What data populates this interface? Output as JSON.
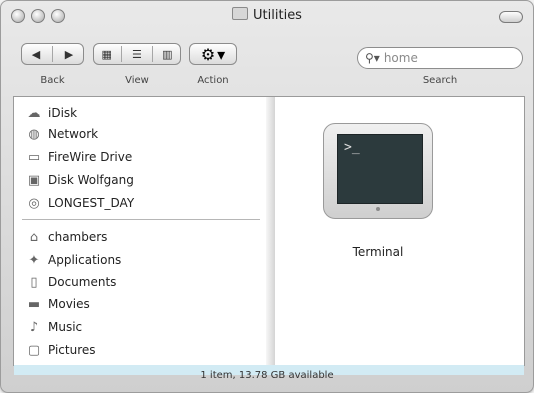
{
  "window": {
    "title": "Utilities"
  },
  "toolbar": {
    "back_label": "Back",
    "view_label": "View",
    "action_label": "Action",
    "search_label": "Search",
    "search_placeholder": "home"
  },
  "sidebar": {
    "devices": [
      {
        "label": "iDisk",
        "icon": "idisk-icon"
      },
      {
        "label": "Network",
        "icon": "network-icon"
      },
      {
        "label": "FireWire Drive",
        "icon": "drive-icon"
      },
      {
        "label": "Disk Wolfgang",
        "icon": "disk-icon"
      },
      {
        "label": "LONGEST_DAY",
        "icon": "cd-icon"
      }
    ],
    "places": [
      {
        "label": "chambers",
        "icon": "home-icon"
      },
      {
        "label": "Applications",
        "icon": "applications-icon"
      },
      {
        "label": "Documents",
        "icon": "documents-icon"
      },
      {
        "label": "Movies",
        "icon": "movies-icon"
      },
      {
        "label": "Music",
        "icon": "music-icon"
      },
      {
        "label": "Pictures",
        "icon": "pictures-icon"
      }
    ]
  },
  "main": {
    "items": [
      {
        "label": "Terminal",
        "icon": "terminal-icon"
      }
    ]
  },
  "status": {
    "text": "1 item, 13.78 GB available"
  }
}
